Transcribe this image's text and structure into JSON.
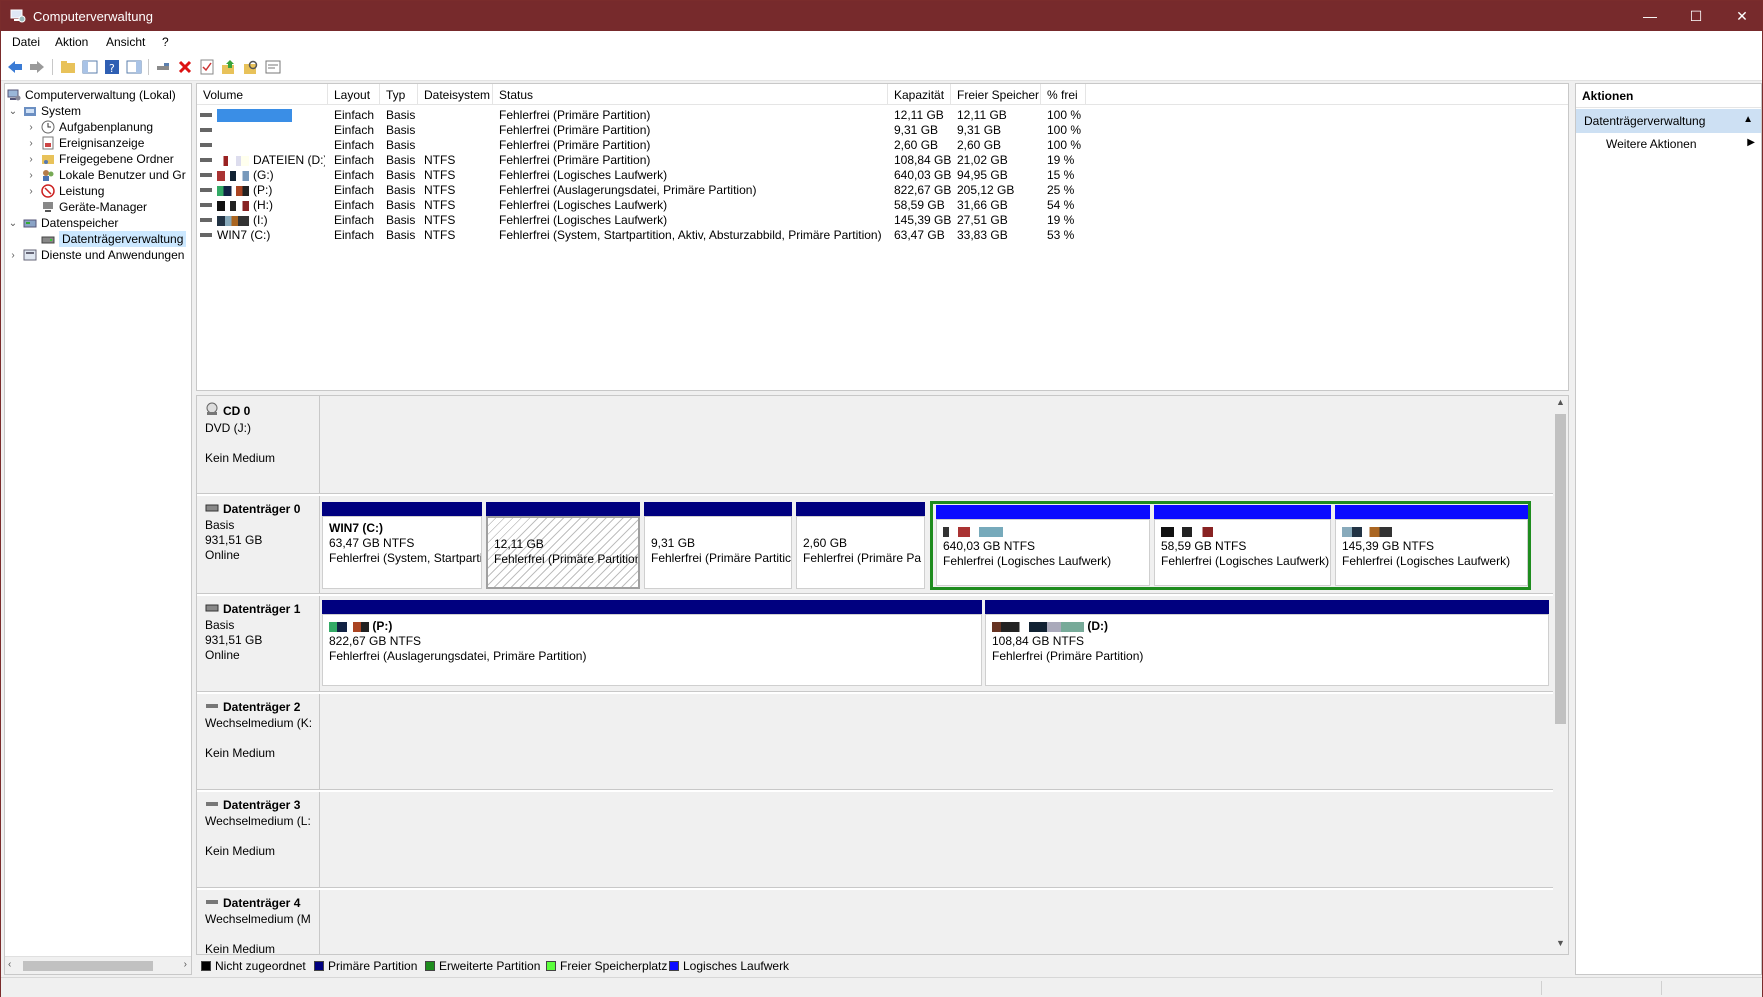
{
  "window": {
    "title": "Computerverwaltung",
    "min": "—",
    "max": "☐",
    "close": "✕"
  },
  "menu": [
    "Datei",
    "Aktion",
    "Ansicht",
    "?"
  ],
  "toolbar": {
    "icons": [
      "back-icon",
      "forward-icon",
      "up-folder-icon",
      "show-hide-tree-icon",
      "help-icon",
      "properties-pane-icon",
      "connect-icon",
      "delete-icon",
      "check-icon",
      "export-icon",
      "search-icon",
      "settings-icon"
    ]
  },
  "tree": {
    "items": [
      {
        "label": "Computerverwaltung (Lokal)",
        "icon": "computer-icon"
      },
      {
        "label": "System",
        "icon": "system-icon",
        "chevron": "⌄"
      },
      {
        "label": "Aufgabenplanung",
        "icon": "clock-icon",
        "chevron": "›"
      },
      {
        "label": "Ereignisanzeige",
        "icon": "event-viewer-icon",
        "chevron": "›"
      },
      {
        "label": "Freigegebene Ordner",
        "icon": "shared-folder-icon",
        "chevron": "›"
      },
      {
        "label": "Lokale Benutzer und Gr",
        "icon": "users-icon",
        "chevron": "›"
      },
      {
        "label": "Leistung",
        "icon": "performance-icon",
        "chevron": "›"
      },
      {
        "label": "Geräte-Manager",
        "icon": "device-manager-icon"
      },
      {
        "label": "Datenspeicher",
        "icon": "storage-icon",
        "chevron": "⌄"
      },
      {
        "label": "Datenträgerverwaltung",
        "icon": "disk-management-icon"
      },
      {
        "label": "Dienste und Anwendungen",
        "icon": "services-icon",
        "chevron": "›"
      }
    ]
  },
  "volumes": {
    "headers": [
      "Volume",
      "Layout",
      "Typ",
      "Dateisystem",
      "Status",
      "Kapazität",
      "Freier Speicher",
      "% frei"
    ],
    "rows": [
      {
        "volume": "",
        "layout": "Einfach",
        "typ": "Basis",
        "fs": "",
        "status": "Fehlerfrei (Primäre Partition)",
        "cap": "12,11 GB",
        "free": "12,11 GB",
        "pct": "100 %"
      },
      {
        "volume": "",
        "layout": "Einfach",
        "typ": "Basis",
        "fs": "",
        "status": "Fehlerfrei (Primäre Partition)",
        "cap": "9,31 GB",
        "free": "9,31 GB",
        "pct": "100 %"
      },
      {
        "volume": "",
        "layout": "Einfach",
        "typ": "Basis",
        "fs": "",
        "status": "Fehlerfrei (Primäre Partition)",
        "cap": "2,60 GB",
        "free": "2,60 GB",
        "pct": "100 %"
      },
      {
        "volume": "DATEIEN (D:)",
        "layout": "Einfach",
        "typ": "Basis",
        "fs": "NTFS",
        "status": "Fehlerfrei (Primäre Partition)",
        "cap": "108,84 GB",
        "free": "21,02 GB",
        "pct": "19 %"
      },
      {
        "volume": "(G:)",
        "layout": "Einfach",
        "typ": "Basis",
        "fs": "NTFS",
        "status": "Fehlerfrei (Logisches Laufwerk)",
        "cap": "640,03 GB",
        "free": "94,95 GB",
        "pct": "15 %"
      },
      {
        "volume": "(P:)",
        "layout": "Einfach",
        "typ": "Basis",
        "fs": "NTFS",
        "status": "Fehlerfrei (Auslagerungsdatei, Primäre Partition)",
        "cap": "822,67 GB",
        "free": "205,12 GB",
        "pct": "25 %"
      },
      {
        "volume": "(H:)",
        "layout": "Einfach",
        "typ": "Basis",
        "fs": "NTFS",
        "status": "Fehlerfrei (Logisches Laufwerk)",
        "cap": "58,59 GB",
        "free": "31,66 GB",
        "pct": "54 %"
      },
      {
        "volume": "(I:)",
        "layout": "Einfach",
        "typ": "Basis",
        "fs": "NTFS",
        "status": "Fehlerfrei (Logisches Laufwerk)",
        "cap": "145,39 GB",
        "free": "27,51 GB",
        "pct": "19 %"
      },
      {
        "volume": "WIN7 (C:)",
        "layout": "Einfach",
        "typ": "Basis",
        "fs": "NTFS",
        "status": "Fehlerfrei (System, Startpartition, Aktiv, Absturzabbild, Primäre Partition)",
        "cap": "63,47 GB",
        "free": "33,83 GB",
        "pct": "53 %"
      }
    ]
  },
  "disks": {
    "cd0": {
      "title": "CD 0",
      "line1": "DVD (J:)",
      "line3": "Kein Medium"
    },
    "disk0": {
      "title": "Datenträger 0",
      "line1": "Basis",
      "line2": "931,51 GB",
      "line3": "Online",
      "parts": [
        {
          "name": "WIN7  (C:)",
          "size": "63,47 GB NTFS",
          "status": "Fehlerfrei (System, Startpartition"
        },
        {
          "name": "",
          "size": "12,11 GB",
          "status": "Fehlerfrei (Primäre Partition"
        },
        {
          "name": "",
          "size": "9,31 GB",
          "status": "Fehlerfrei (Primäre Partitic"
        },
        {
          "name": "",
          "size": "2,60 GB",
          "status": "Fehlerfrei (Primäre Pa"
        },
        {
          "name": "",
          "size": "640,03 GB NTFS",
          "status": "Fehlerfrei (Logisches Laufwerk)"
        },
        {
          "name": "",
          "size": "58,59 GB NTFS",
          "status": "Fehlerfrei (Logisches Laufwerk)"
        },
        {
          "name": "",
          "size": "145,39 GB NTFS",
          "status": "Fehlerfrei (Logisches Laufwerk)"
        }
      ]
    },
    "disk1": {
      "title": "Datenträger 1",
      "line1": "Basis",
      "line2": "931,51 GB",
      "line3": "Online",
      "parts": [
        {
          "name": "(P:)",
          "size": "822,67 GB NTFS",
          "status": "Fehlerfrei (Auslagerungsdatei, Primäre Partition)"
        },
        {
          "name": "(D:)",
          "size": "108,84 GB NTFS",
          "status": "Fehlerfrei (Primäre Partition)"
        }
      ]
    },
    "disk2": {
      "title": "Datenträger 2",
      "line1": "Wechselmedium (K:",
      "line3": "Kein Medium"
    },
    "disk3": {
      "title": "Datenträger 3",
      "line1": "Wechselmedium (L:",
      "line3": "Kein Medium"
    },
    "disk4": {
      "title": "Datenträger 4",
      "line1": "Wechselmedium (M",
      "line3": "Kein Medium"
    }
  },
  "legend": [
    {
      "label": "Nicht zugeordnet",
      "color": "#000000"
    },
    {
      "label": "Primäre Partition",
      "color": "#00007f"
    },
    {
      "label": "Erweiterte Partition",
      "color": "#1e8c1e"
    },
    {
      "label": "Freier Speicherplatz",
      "color": "#5cff3c"
    },
    {
      "label": "Logisches Laufwerk",
      "color": "#0a0aff"
    }
  ],
  "actions": {
    "header": "Aktionen",
    "section": "Datenträgerverwaltung",
    "item": "Weitere Aktionen"
  },
  "colors": {
    "titlebar": "#772a2c",
    "primary": "#00007f",
    "logical": "#0a0aff",
    "extended": "#1e8c1e",
    "selection": "#cce8ff"
  }
}
